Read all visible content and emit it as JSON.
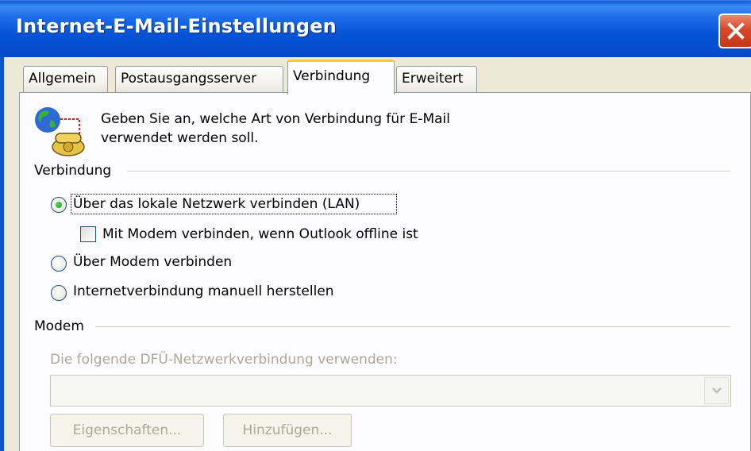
{
  "window": {
    "title": "Internet-E-Mail-Einstellungen"
  },
  "tabs": [
    {
      "label": "Allgemein",
      "active": false
    },
    {
      "label": "Postausgangsserver",
      "active": false
    },
    {
      "label": "Verbindung",
      "active": true
    },
    {
      "label": "Erweitert",
      "active": false
    }
  ],
  "panel": {
    "description_line1": "Geben Sie an, welche Art von Verbindung für E-Mail",
    "description_line2": "verwendet werden soll.",
    "connection_group": {
      "label": "Verbindung",
      "options": [
        {
          "label": "Über das lokale Netzwerk verbinden (LAN)",
          "selected": true
        },
        {
          "label": "Über Modem verbinden",
          "selected": false
        },
        {
          "label": "Internetverbindung manuell herstellen",
          "selected": false
        }
      ],
      "modem_offline_checkbox": {
        "label": "Mit Modem verbinden, wenn Outlook offline ist",
        "checked": false
      }
    },
    "modem_group": {
      "label": "Modem",
      "dialup_label": "Die folgende DFÜ-Netzwerkverbindung verwenden:",
      "dialup_value": "",
      "properties_button": "Eigenschaften...",
      "add_button": "Hinzufügen..."
    }
  },
  "icons": {
    "close": "close-icon",
    "connection": "globe-telephone-icon",
    "dropdown": "chevron-down-icon"
  },
  "colors": {
    "titlebar": "#0553d6",
    "dialog_bg": "#ece9d8",
    "active_tab_accent": "#ffc83c",
    "disabled_text": "#aca899"
  }
}
